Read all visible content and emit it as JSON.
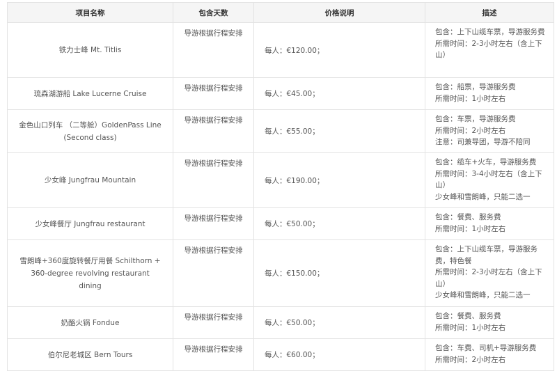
{
  "headers": [
    "项目名称",
    "包含天数",
    "价格说明",
    "描述"
  ],
  "rows": [
    {
      "name": "铁力士峰 Mt. Titlis",
      "days": "导游根据行程安排",
      "price": "每人：€120.00；",
      "desc": [
        "包含：上下山缆车票，导游服务费",
        "所需时间：2-3小时左右（含上下山）"
      ]
    },
    {
      "name": "琉森湖游船 Lake Lucerne Cruise",
      "days": "导游根据行程安排",
      "price": "每人：€45.00；",
      "desc": [
        "包含：船票，导游服务费",
        "所需时间：1小时左右"
      ]
    },
    {
      "name": "金色山口列车 （二等舱）GoldenPass Line (Second class)",
      "days": "导游根据行程安排",
      "price": "每人：€55.00；",
      "desc": [
        "包含：车票，导游服务费",
        "所需时间：2小时左右",
        "注意：司兼导团，导游不陪同"
      ]
    },
    {
      "name": "少女峰 Jungfrau Mountain",
      "days": "导游根据行程安排",
      "price": "每人：€190.00；",
      "desc": [
        "包含：缆车+火车，导游服务费",
        "所需时间：3-4小时左右（含上下山）",
        "少女峰和雪朗峰，只能二选一"
      ]
    },
    {
      "name": "少女峰餐厅 Jungfrau restaurant",
      "days": "导游根据行程安排",
      "price": "每人：€50.00；",
      "desc": [
        "包含：餐费、服务费",
        "所需时间：1小时左右"
      ]
    },
    {
      "name": "雪朗峰+360度旋转餐厅用餐 Schilthorn + 360-degree revolving restaurant dining",
      "days": "导游根据行程安排",
      "price": "每人：€150.00；",
      "desc": [
        "包含：上下山缆车票，导游服务费，特色餐",
        "所需时间：2-3小时左右（含上下山）",
        "少女峰和雪朗峰，只能二选一"
      ]
    },
    {
      "name": "奶酪火锅 Fondue",
      "days": "导游根据行程安排",
      "price": "每人：€50.00；",
      "desc": [
        "包含：餐费、服务费",
        "所需时间：1小时左右"
      ]
    },
    {
      "name": "伯尔尼老城区 Bern Tours",
      "days": "导游根据行程安排",
      "price": "每人：€60.00；",
      "desc": [
        "包含：车费、司机+导游服务费",
        "所需时间：2小时左右"
      ]
    }
  ]
}
